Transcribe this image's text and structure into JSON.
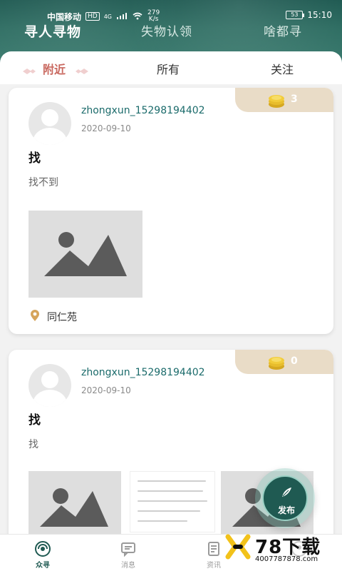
{
  "status_bar": {
    "carrier": "中国移动",
    "hd": "HD",
    "network_type": "4G",
    "speed_value": "279",
    "speed_unit": "K/s",
    "battery": "53",
    "time": "15:10"
  },
  "top_tabs": [
    "寻人寻物",
    "失物认领",
    "啥都寻"
  ],
  "sub_tabs": {
    "nearby": "附近",
    "all": "所有",
    "follow": "关注"
  },
  "posts": [
    {
      "username": "zhongxun_15298194402",
      "date": "2020-09-10",
      "coins": "3",
      "title": "找",
      "content": "找不到",
      "location": "同仁苑"
    },
    {
      "username": "zhongxun_15298194402",
      "date": "2020-09-10",
      "coins": "0",
      "title": "找",
      "content": "找"
    }
  ],
  "fab": {
    "label": "发布"
  },
  "bottom_nav": [
    "众寻",
    "消息",
    "资讯",
    ""
  ],
  "watermark": {
    "big": "78下载",
    "small": "4007787878.com"
  }
}
